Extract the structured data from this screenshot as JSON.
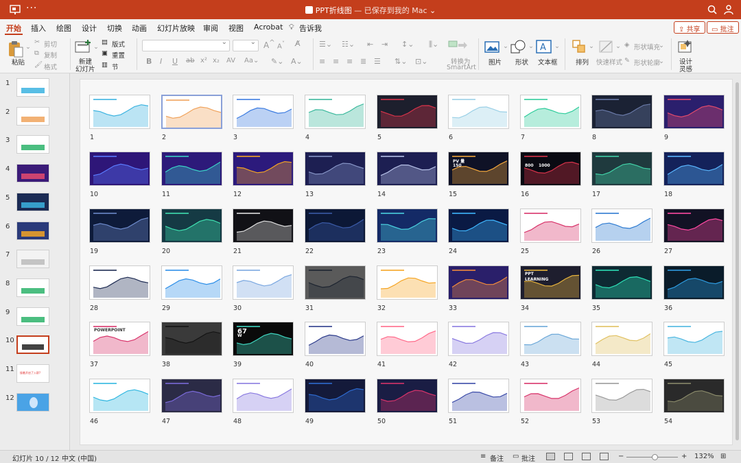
{
  "titlebar": {
    "document_title": "PPT折线图",
    "separator": "—",
    "save_status": "已保存到我的 Mac",
    "more_dots": "···"
  },
  "tabs": [
    "开始",
    "插入",
    "绘图",
    "设计",
    "切换",
    "动画",
    "幻灯片放映",
    "审阅",
    "视图",
    "Acrobat",
    "告诉我"
  ],
  "active_tab": "开始",
  "share_label": "共享",
  "comments_label": "批注",
  "ribbon": {
    "paste": "粘贴",
    "cut": "剪切",
    "copy": "复制",
    "format": "格式",
    "new_slide_line1": "新建",
    "new_slide_line2": "幻灯片",
    "layout": "版式",
    "reset": "重置",
    "section": "节",
    "font_size_up": "A",
    "font_size_down": "A",
    "convert_smartart_line1": "转换为",
    "convert_smartart_line2": "SmartArt",
    "picture": "图片",
    "shape": "形状",
    "textbox": "文本框",
    "arrange": "排列",
    "quick_styles": "快速样式",
    "shape_fill": "形状填充",
    "shape_outline": "形状轮廓",
    "designer_line1": "设计",
    "designer_line2": "灵感"
  },
  "left_thumbnails": [
    {
      "num": "1",
      "bg": "#ffffff",
      "accent": "#3bb3e0"
    },
    {
      "num": "2",
      "bg": "#ffffff",
      "accent": "#f0a35c"
    },
    {
      "num": "3",
      "bg": "#ffffff",
      "accent": "#2bb36a"
    },
    {
      "num": "4",
      "bg": "#3b1b78",
      "accent": "#e84a6f"
    },
    {
      "num": "5",
      "bg": "#1b2b54",
      "accent": "#3bb3e0"
    },
    {
      "num": "6",
      "bg": "#2a3a7a",
      "accent": "#f5a524"
    },
    {
      "num": "7",
      "bg": "#f3f3f3",
      "accent": "#bbbbbb"
    },
    {
      "num": "8",
      "bg": "#ffffff",
      "accent": "#2bb36a"
    },
    {
      "num": "9",
      "bg": "#ffffff",
      "accent": "#2bb36a"
    },
    {
      "num": "10",
      "bg": "#ffffff",
      "accent": "#222222"
    },
    {
      "num": "11",
      "bg": "#ffffff",
      "accent": "#e03030"
    },
    {
      "num": "12",
      "bg": "#4aa3e6",
      "accent": "#cfe6fb"
    }
  ],
  "left_thumb_11_text": "接着开启了入职?",
  "selected_slide": "10",
  "slides": [
    {
      "num": "1",
      "bg": "#ffffff",
      "accent": "#3bb3e0"
    },
    {
      "num": "2",
      "bg": "#ffffff",
      "accent": "#f0a35c"
    },
    {
      "num": "3",
      "bg": "#ffffff",
      "accent": "#3b7be0"
    },
    {
      "num": "4",
      "bg": "#ffffff",
      "accent": "#39b89c"
    },
    {
      "num": "5",
      "bg": "#1d1f2d",
      "accent": "#d8334a"
    },
    {
      "num": "6",
      "bg": "#ffffff",
      "accent": "#9ad0e6"
    },
    {
      "num": "7",
      "bg": "#ffffff",
      "accent": "#2ecc9b"
    },
    {
      "num": "8",
      "bg": "#1b2234",
      "accent": "#6a7aa8"
    },
    {
      "num": "9",
      "bg": "#2b1f6d",
      "accent": "#e24a6c"
    },
    {
      "num": "10",
      "bg": "#2e1678",
      "accent": "#5a7bff"
    },
    {
      "num": "11",
      "bg": "#2d1a7a",
      "accent": "#3ad1c6"
    },
    {
      "num": "12",
      "bg": "#2c1a7c",
      "accent": "#f5a524"
    },
    {
      "num": "13",
      "bg": "#1d1f52",
      "accent": "#8896c8"
    },
    {
      "num": "14",
      "bg": "#1d1f52",
      "accent": "#b7c1e8"
    },
    {
      "num": "15",
      "bg": "#0f1226",
      "accent": "#f0a53c"
    },
    {
      "num": "16",
      "bg": "#0a0a12",
      "accent": "#d8334a"
    },
    {
      "num": "17",
      "bg": "#1f3a3e",
      "accent": "#41d1a7"
    },
    {
      "num": "18",
      "bg": "#14225a",
      "accent": "#5ab6ff"
    },
    {
      "num": "19",
      "bg": "#0e1b3a",
      "accent": "#6d8acb"
    },
    {
      "num": "20",
      "bg": "#153a44",
      "accent": "#3fe0b0"
    },
    {
      "num": "21",
      "bg": "#111116",
      "accent": "#e0e0e0"
    },
    {
      "num": "22",
      "bg": "#0c1836",
      "accent": "#3b5ba8"
    },
    {
      "num": "23",
      "bg": "#142a66",
      "accent": "#4ad1e0"
    },
    {
      "num": "24",
      "bg": "#0a1a44",
      "accent": "#3fb6ff"
    },
    {
      "num": "25",
      "bg": "#ffffff",
      "accent": "#d8336a"
    },
    {
      "num": "26",
      "bg": "#ffffff",
      "accent": "#2e7bd1"
    },
    {
      "num": "27",
      "bg": "#121224",
      "accent": "#ff4aa3"
    },
    {
      "num": "28",
      "bg": "#ffffff",
      "accent": "#1d2b52"
    },
    {
      "num": "29",
      "bg": "#ffffff",
      "accent": "#2e8fe8"
    },
    {
      "num": "30",
      "bg": "#ffffff",
      "accent": "#7aa7e0"
    },
    {
      "num": "31",
      "bg": "#5a5a5a",
      "accent": "#1d2430"
    },
    {
      "num": "32",
      "bg": "#ffffff",
      "accent": "#f5a524"
    },
    {
      "num": "33",
      "bg": "#2a1f6a",
      "accent": "#f08a3c"
    },
    {
      "num": "34",
      "bg": "#1e1e2e",
      "accent": "#e8b43c"
    },
    {
      "num": "35",
      "bg": "#0e2a33",
      "accent": "#2de0b6"
    },
    {
      "num": "36",
      "bg": "#0a1c2a",
      "accent": "#2e9be0"
    },
    {
      "num": "37",
      "bg": "#ffffff",
      "accent": "#d8336a"
    },
    {
      "num": "38",
      "bg": "#3a3a3a",
      "accent": "#141414"
    },
    {
      "num": "39",
      "bg": "#0a0a0a",
      "accent": "#3fd6c0"
    },
    {
      "num": "40",
      "bg": "#ffffff",
      "accent": "#2b3a8a"
    },
    {
      "num": "41",
      "bg": "#ffffff",
      "accent": "#ff6a8a"
    },
    {
      "num": "42",
      "bg": "#ffffff",
      "accent": "#8a7ae0"
    },
    {
      "num": "43",
      "bg": "#ffffff",
      "accent": "#6aa7d8"
    },
    {
      "num": "44",
      "bg": "#ffffff",
      "accent": "#e0c060"
    },
    {
      "num": "45",
      "bg": "#ffffff",
      "accent": "#4ab6e0"
    },
    {
      "num": "46",
      "bg": "#ffffff",
      "accent": "#2eb6e0"
    },
    {
      "num": "47",
      "bg": "#2b2b46",
      "accent": "#7a6ad8"
    },
    {
      "num": "48",
      "bg": "#ffffff",
      "accent": "#8a7ae0"
    },
    {
      "num": "49",
      "bg": "#141a3a",
      "accent": "#2e6bd1"
    },
    {
      "num": "50",
      "bg": "#1a1d44",
      "accent": "#d8336a"
    },
    {
      "num": "51",
      "bg": "#ffffff",
      "accent": "#3a4aa8"
    },
    {
      "num": "52",
      "bg": "#ffffff",
      "accent": "#d8336a"
    },
    {
      "num": "53",
      "bg": "#ffffff",
      "accent": "#9a9a9a"
    },
    {
      "num": "54",
      "bg": "#2a2a2a",
      "accent": "#8a8a6a"
    }
  ],
  "slide_texts": {
    "15": {
      "a": "PV 量",
      "b": "150"
    },
    "16": {
      "a": "800",
      "b": "1000"
    },
    "34": {
      "a": "PPT",
      "b": "LEARNING"
    },
    "37": {
      "a": "POWERPOINT"
    },
    "39": {
      "a": "67",
      "b": "W"
    }
  },
  "statusbar": {
    "slide_info": "幻灯片 10 / 12",
    "language": "中文 (中国)",
    "notes": "备注",
    "comments": "批注",
    "zoom_minus": "−",
    "zoom_plus": "+",
    "zoom_level": "132%"
  },
  "colors": {
    "brand": "#c43e1c",
    "selection": "#c43e1c"
  }
}
